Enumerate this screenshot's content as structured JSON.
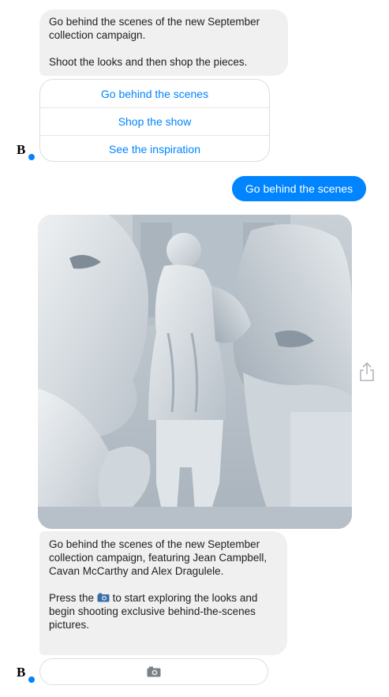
{
  "bot": {
    "avatar_letter": "B"
  },
  "messages": {
    "top_bubble": {
      "line1": "Go behind the scenes of the new September collection campaign.",
      "line2": "Shoot the looks and then shop the pieces."
    },
    "quick_replies": [
      {
        "label": "Go behind the scenes"
      },
      {
        "label": "Shop the show"
      },
      {
        "label": "See the inspiration"
      }
    ],
    "user_reply": "Go behind the scenes",
    "bottom_bubble": {
      "paragraph1": "Go behind the scenes of the new September collection campaign, featuring Jean Campbell, Cavan McCarthy and Alex Dragulele.",
      "paragraph2_before": "Press the",
      "paragraph2_after": "to start exploring the looks and begin shooting exclusive behind-the-scenes pictures."
    }
  },
  "icons": {
    "share": "share-icon",
    "camera": "camera-icon",
    "avatar_badge": "messenger-badge-icon"
  },
  "colors": {
    "accent": "#0084ff",
    "bubble_gray": "#f1f0f0",
    "border": "#dadde1"
  }
}
